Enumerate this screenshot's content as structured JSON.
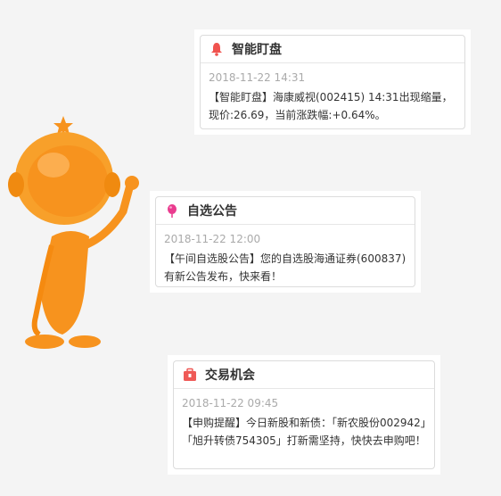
{
  "notifications": [
    {
      "icon": "bell-icon",
      "title": "智能盯盘",
      "time": "2018-11-22 14:31",
      "text": "【智能盯盘】海康威视(002415) 14:31出现缩量，现价:26.69，当前涨跌幅:+0.64%。"
    },
    {
      "icon": "balloon-icon",
      "title": "自选公告",
      "time": "2018-11-22 12:00",
      "text": "【午间自选股公告】您的自选股海通证券(600837)有新公告发布，快来看！"
    },
    {
      "icon": "briefcase-icon",
      "title": "交易机会",
      "time": "2018-11-22 09:45",
      "text": "【申购提醒】今日新股和新债：「新农股份002942」「旭升转债754305」打新需坚持，快快去申购吧！"
    }
  ],
  "colors": {
    "bell": "#f0534f",
    "balloon": "#ea3c8f",
    "briefcase": "#ef5a57",
    "mascot": "#f7931e"
  }
}
